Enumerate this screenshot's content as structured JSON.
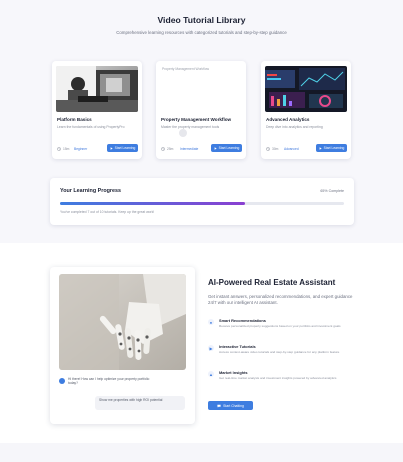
{
  "header": {
    "title": "Video Tutorial Library",
    "subtitle": "Comprehensive learning resources with categorized tutorials and step-by-step guidance"
  },
  "cards": [
    {
      "title": "Platform Basics",
      "description": "Learn the fundamentals of using PropertyPro",
      "duration": "15m",
      "level": "Beginner",
      "button": "Start Learning",
      "image_alt": ""
    },
    {
      "title": "Property Management Workflow",
      "description": "Master the property management tools",
      "duration": "25m",
      "level": "Intermediate",
      "button": "Start Learning",
      "image_alt": "Property Management Workflow"
    },
    {
      "title": "Advanced Analytics",
      "description": "Deep dive into analytics and reporting",
      "duration": "30m",
      "level": "Advanced",
      "button": "Start Learning",
      "image_alt": ""
    }
  ],
  "progress": {
    "title": "Your Learning Progress",
    "percent_label": "65% Complete",
    "value": 0.65,
    "note": "You've completed 7 out of 10 tutorials. Keep up the great work!"
  },
  "assistant": {
    "title": "AI-Powered Real Estate Assistant",
    "description": "Get instant answers, personalized recommendations, and expert guidance 24/7 with our intelligent AI assistant.",
    "bot_message": "Hi there! How can I help optimize your property portfolio today?",
    "user_message": "Show me properties with high ROI potential",
    "features": [
      {
        "title": "Smart Recommendations",
        "description": "Receive personalized property suggestions based on your portfolio and investment goals"
      },
      {
        "title": "Interactive Tutorials",
        "description": "Access context-aware video tutorials and step-by-step guidance for any platform feature"
      },
      {
        "title": "Market Insights",
        "description": "Get real-time market analysis and investment insights powered by advanced analytics"
      }
    ],
    "button": "Start Chatting"
  },
  "colors": {
    "accent": "#3e7de0",
    "progress_end": "#8a3fd1"
  }
}
